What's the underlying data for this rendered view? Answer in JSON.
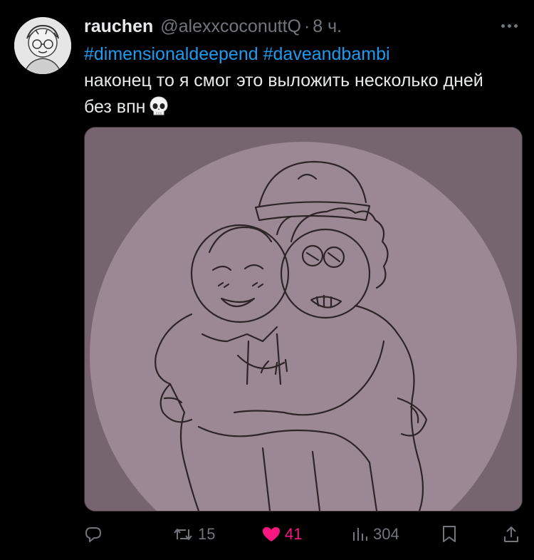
{
  "tweet": {
    "author_name": "rauchen",
    "handle": "@alexxcoconuttQ",
    "separator": "·",
    "time": "8 ч.",
    "hashtag1": "#dimensionaldeepend",
    "hashtag2": "#daveandbambi",
    "body_line": "наконец то я смог это выложить несколько дней без впн",
    "emoji": "skull"
  },
  "actions": {
    "reply_count": "",
    "retweet_count": "15",
    "like_count": "41",
    "view_count": "304"
  },
  "colors": {
    "background": "#000000",
    "text": "#e7e9ea",
    "muted": "#71767b",
    "link": "#1d9bf0",
    "like": "#f91880"
  }
}
